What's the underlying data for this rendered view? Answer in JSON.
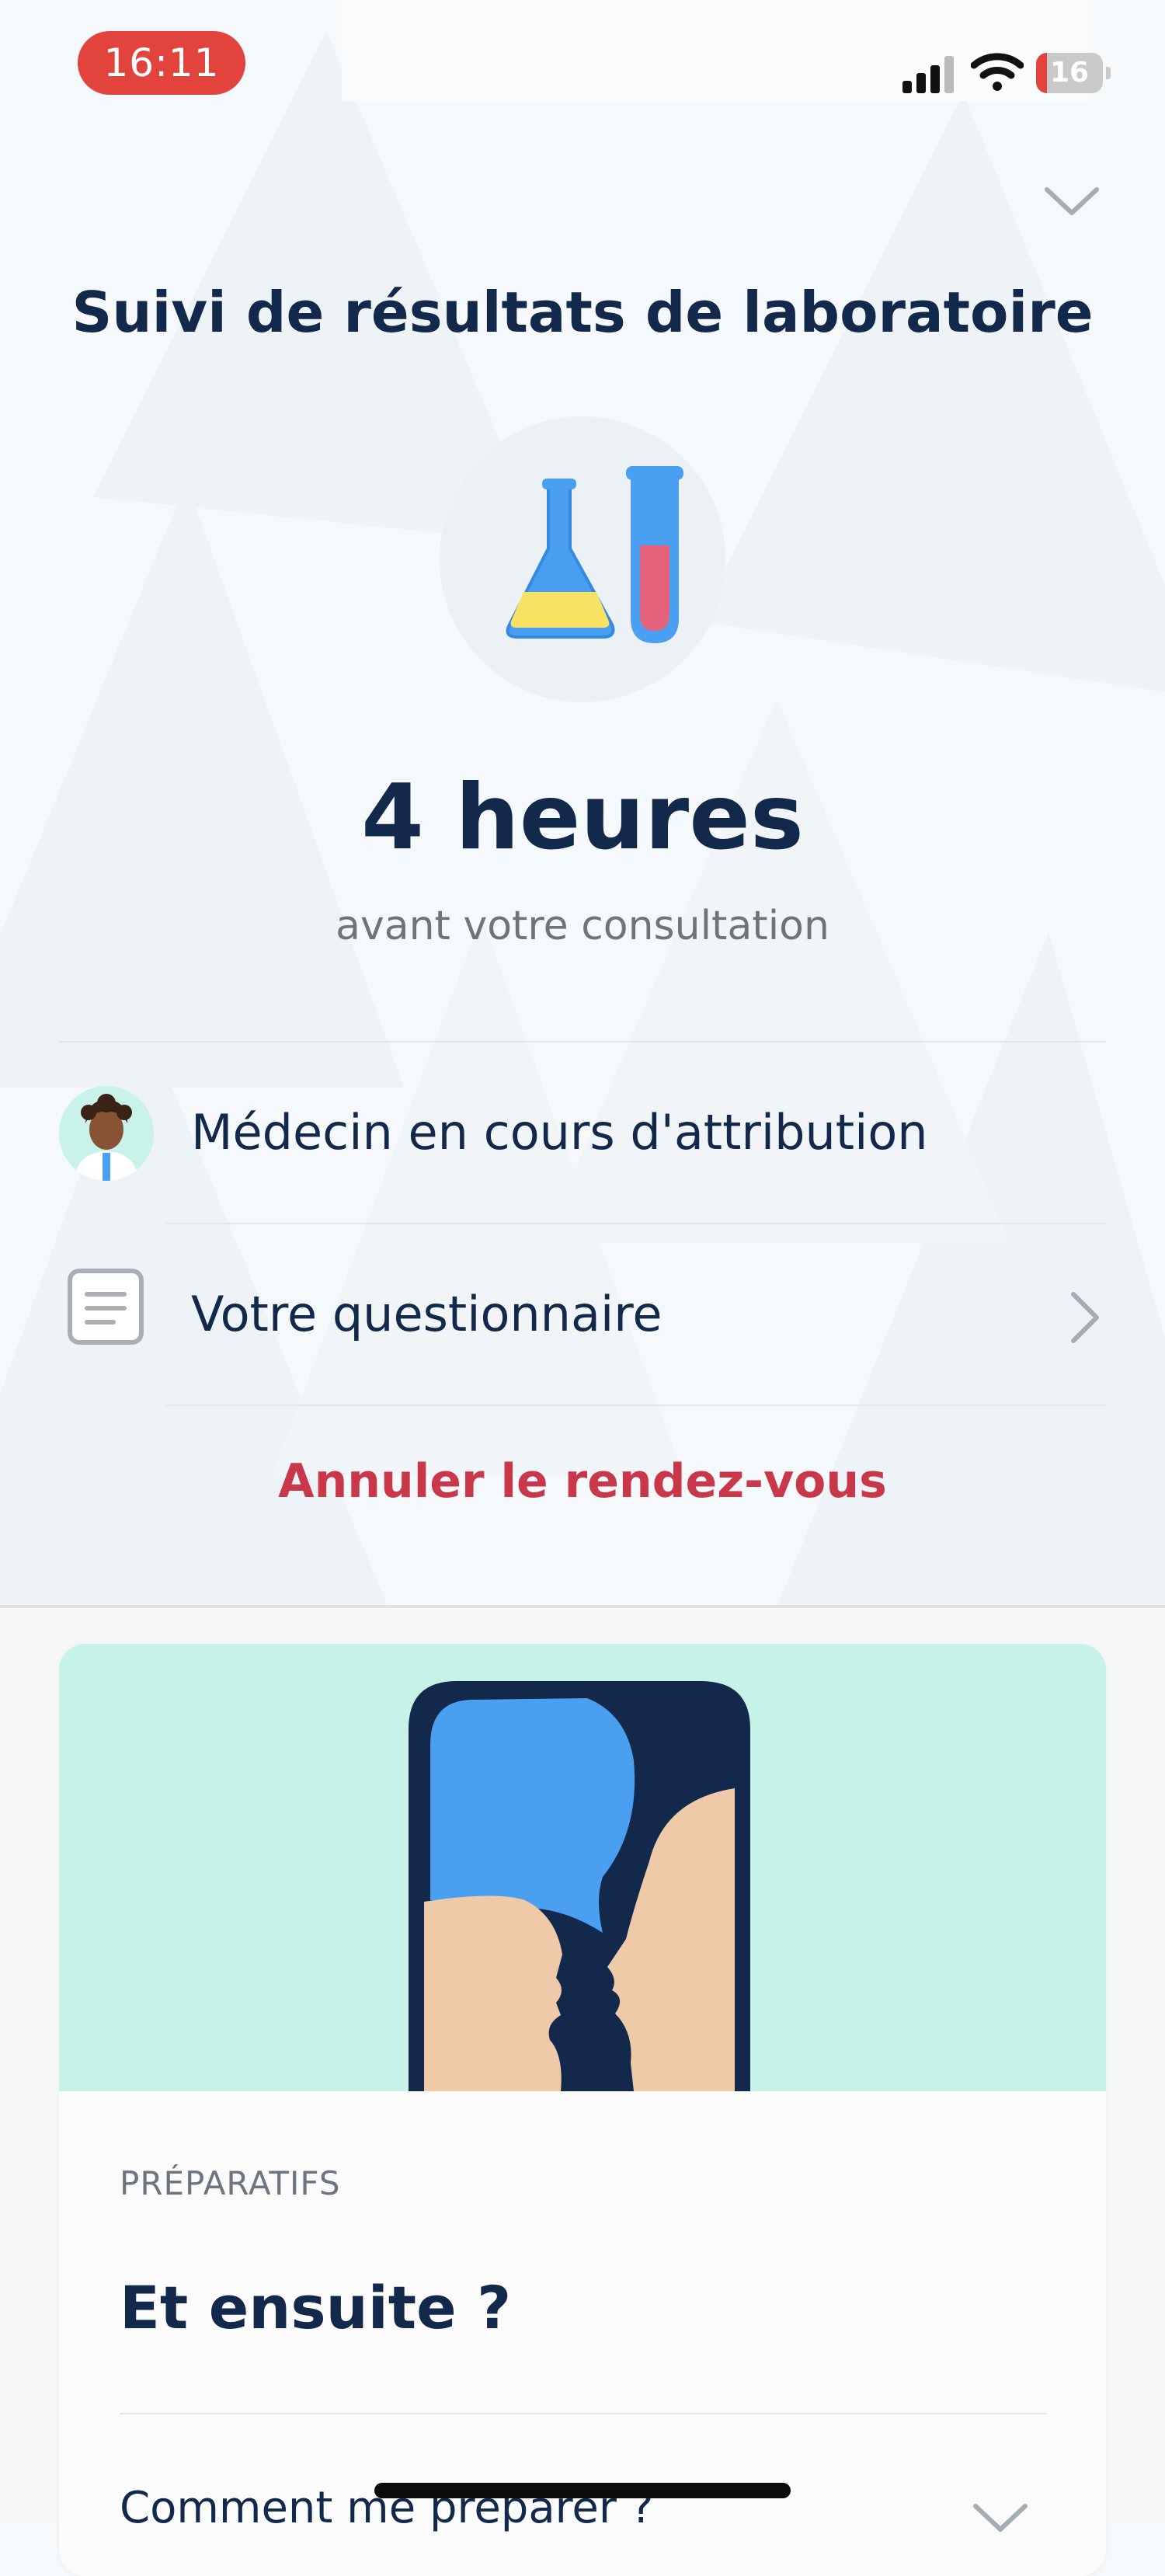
{
  "status_bar": {
    "time": "16:11",
    "battery_level": "16",
    "battery_fraction": 0.16,
    "accent_color": "#e2433d"
  },
  "header": {
    "collapse_icon": "chevron-down-icon",
    "title": "Suivi de résultats de laboratoire",
    "illustration_icon": "lab-flask-and-tube-icon"
  },
  "countdown": {
    "value": "4 heures",
    "caption": "avant votre consultation"
  },
  "list": {
    "items": [
      {
        "icon": "doctor-avatar-icon",
        "label": "Médecin en cours d'attribution"
      },
      {
        "icon": "questionnaire-document-icon",
        "label": "Votre questionnaire",
        "chevron": "chevron-right-icon"
      }
    ]
  },
  "cancel_label": "Annuler le rendez-vous",
  "cancel_color": "#c8374a",
  "card": {
    "illustration_icon": "two-faces-phone-illustration",
    "eyebrow": "PRÉPARATIFS",
    "title": "Et ensuite ?",
    "accordion_label": "Comment me préparer ?",
    "hero_color": "#c6f2e7"
  }
}
